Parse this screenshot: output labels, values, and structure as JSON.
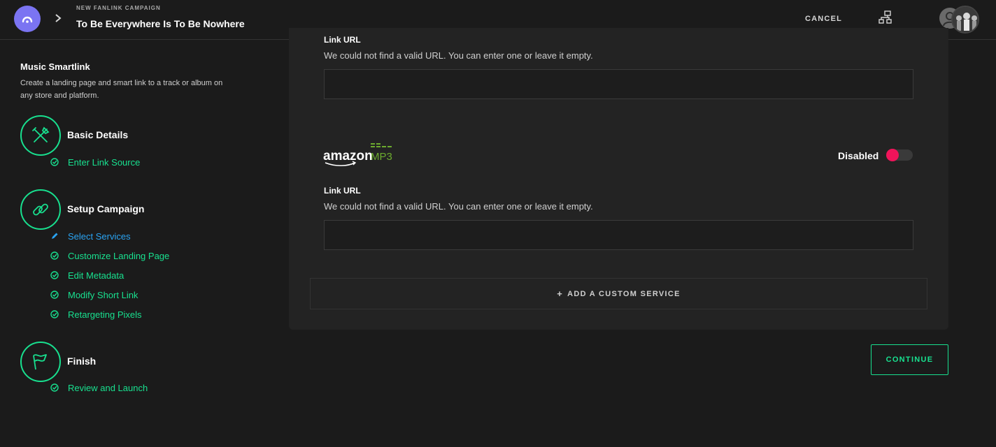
{
  "header": {
    "kicker": "NEW FANLINK CAMPAIGN",
    "title": "To Be Everywhere Is To Be Nowhere",
    "cancel_label": "CANCEL"
  },
  "sidebar": {
    "title": "Music Smartlink",
    "description": "Create a landing page and smart link to a track or album on any store and platform.",
    "steps": [
      {
        "title": "Basic Details",
        "icon": "tools-icon",
        "items": [
          {
            "label": "Enter Link Source",
            "state": "done"
          }
        ]
      },
      {
        "title": "Setup Campaign",
        "icon": "link-icon",
        "items": [
          {
            "label": "Select Services",
            "state": "active"
          },
          {
            "label": "Customize Landing Page",
            "state": "done"
          },
          {
            "label": "Edit Metadata",
            "state": "done"
          },
          {
            "label": "Modify Short Link",
            "state": "done"
          },
          {
            "label": "Retargeting Pixels",
            "state": "done"
          }
        ]
      },
      {
        "title": "Finish",
        "icon": "flag-icon",
        "items": [
          {
            "label": "Review and Launch",
            "state": "done"
          }
        ]
      }
    ]
  },
  "services": {
    "prev_link_label": "Link URL",
    "prev_note": "We could not find a valid URL. You can enter one or leave it empty.",
    "prev_value": "",
    "amazon": {
      "logo_text": "amazon",
      "logo_suffix": "MP3",
      "status_label": "Disabled",
      "enabled": false,
      "link_label": "Link URL",
      "note": "We could not find a valid URL. You can enter one or leave it empty.",
      "value": ""
    },
    "add_custom_label": "ADD A CUSTOM SERVICE"
  },
  "footer": {
    "continue_label": "CONTINUE"
  },
  "colors": {
    "accent_green": "#18e08f",
    "active_blue": "#2aa3f2",
    "toggle_red": "#f0145a",
    "logo_purple": "#7b74f2",
    "amazon_mp3_green": "#6cab2e"
  }
}
